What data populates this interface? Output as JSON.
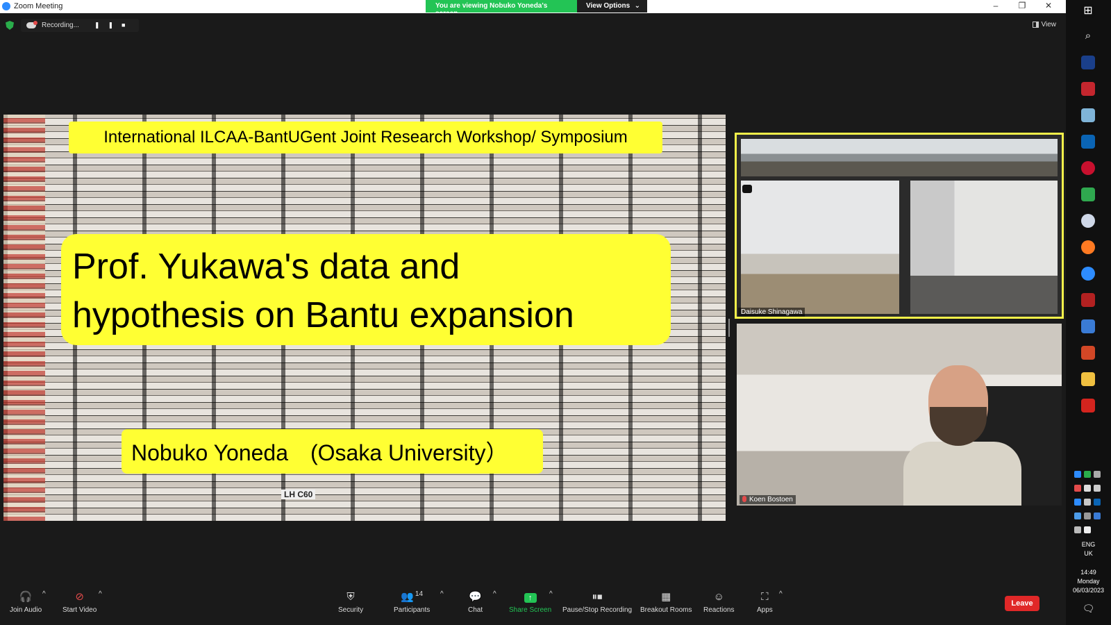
{
  "window": {
    "title": "Zoom Meeting"
  },
  "share_banner": {
    "message": "You are viewing Nobuko Yoneda's screen",
    "options_label": "View Options"
  },
  "window_controls": {
    "minimize": "–",
    "restore": "❐",
    "close": "✕"
  },
  "recording": {
    "label": "Recording..."
  },
  "view_button": {
    "label": "View"
  },
  "slide": {
    "header": "International ILCAA-BantUGent Joint Research Workshop/ Symposium",
    "title_line1": "Prof. Yukawa's data and",
    "title_line2": "hypothesis on Bantu expansion",
    "author": "Nobuko Yoneda　(Osaka University）",
    "tape_label": "LH C60"
  },
  "participants_tiles": [
    {
      "name": "Daisuke Shinagawa"
    },
    {
      "name": "Koen Bostoen"
    }
  ],
  "toolbar": {
    "join_audio": "Join Audio",
    "start_video": "Start Video",
    "security": "Security",
    "participants": "Participants",
    "participants_count": "14",
    "chat": "Chat",
    "share_screen": "Share Screen",
    "pause_stop_recording": "Pause/Stop Recording",
    "breakout_rooms": "Breakout Rooms",
    "reactions": "Reactions",
    "apps": "Apps",
    "leave": "Leave"
  },
  "tray": {
    "lang1": "ENG",
    "lang2": "UK",
    "time": "14:49",
    "day": "Monday",
    "date": "06/03/2023"
  },
  "colors": {
    "zoom_blue": "#2d8cff",
    "share_green": "#23c455",
    "active_speaker": "#f5f14a",
    "leave_red": "#e02828",
    "slide_yellow": "#ffff33"
  }
}
